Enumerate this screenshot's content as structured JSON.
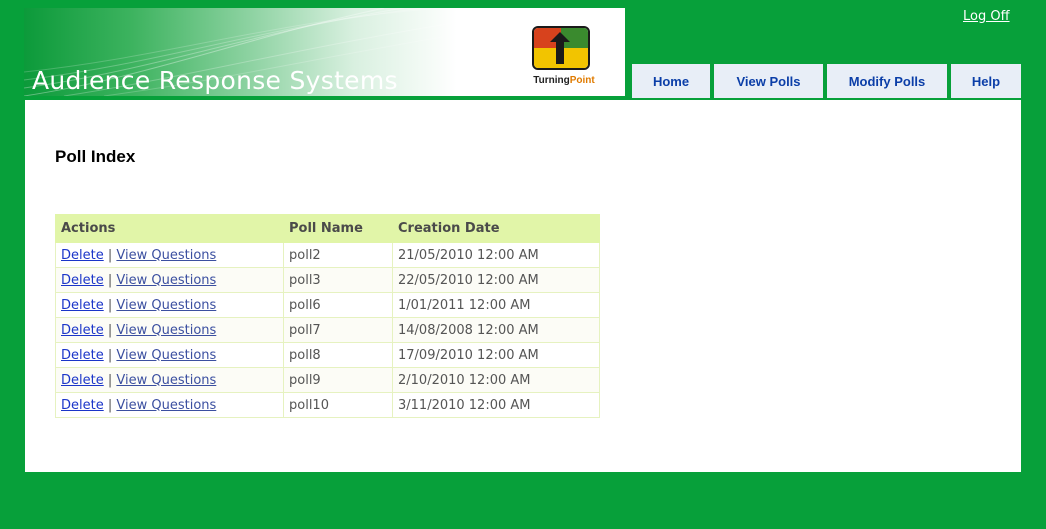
{
  "header": {
    "title": "Audience Response Systems",
    "logo": {
      "brand_text_1": "Turning",
      "brand_text_2": "Point",
      "icon": "turningpoint-logo"
    },
    "logoff_label": "Log Off"
  },
  "nav": {
    "tabs": [
      {
        "label": "Home"
      },
      {
        "label": "View Polls"
      },
      {
        "label": "Modify Polls"
      },
      {
        "label": "Help"
      }
    ]
  },
  "main": {
    "page_title": "Poll Index",
    "table": {
      "headers": [
        "Actions",
        "Poll Name",
        "Creation Date"
      ],
      "action_delete": "Delete",
      "action_separator": "|",
      "action_view": "View Questions",
      "rows": [
        {
          "name": "poll2",
          "date": "21/05/2010 12:00 AM"
        },
        {
          "name": "poll3",
          "date": "22/05/2010 12:00 AM"
        },
        {
          "name": "poll6",
          "date": "1/01/2011 12:00 AM"
        },
        {
          "name": "poll7",
          "date": "14/08/2008 12:00 AM"
        },
        {
          "name": "poll8",
          "date": "17/09/2010 12:00 AM"
        },
        {
          "name": "poll9",
          "date": "2/10/2010 12:00 AM"
        },
        {
          "name": "poll10",
          "date": "3/11/2010 12:00 AM"
        }
      ]
    }
  },
  "colors": {
    "page_background": "#07a03a",
    "tab_background": "#e8eef7",
    "tab_text": "#0b3ea8",
    "table_header": "#e1f5a8",
    "link": "#1b35c9"
  }
}
